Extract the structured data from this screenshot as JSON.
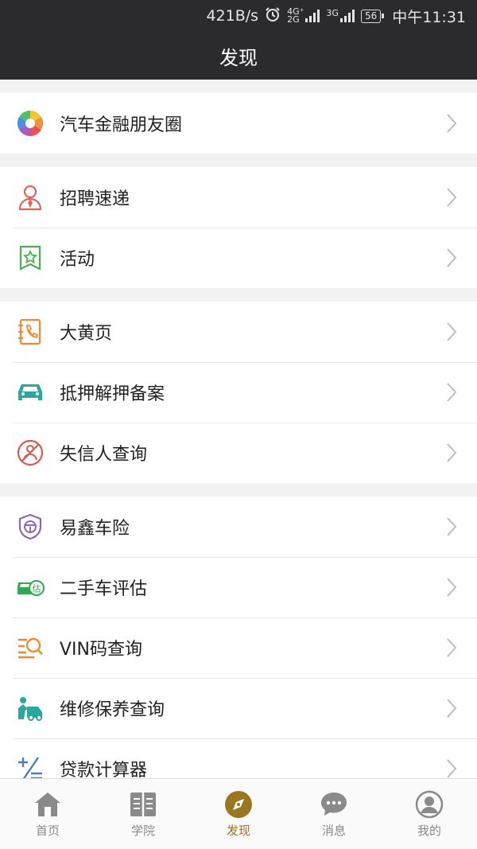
{
  "status_bar": {
    "speed": "421B/s",
    "net1": "4G⁺",
    "net1b": "2G",
    "net2": "3G",
    "battery": "56",
    "time": "中午11:31"
  },
  "header": {
    "title": "发现"
  },
  "groups": [
    {
      "items": [
        {
          "label": "汽车金融朋友圈",
          "icon": "color-aperture-icon"
        }
      ]
    },
    {
      "items": [
        {
          "label": "招聘速递",
          "icon": "person-tie-icon"
        },
        {
          "label": "活动",
          "icon": "star-bookmark-icon"
        }
      ]
    },
    {
      "items": [
        {
          "label": "大黄页",
          "icon": "phone-book-icon"
        },
        {
          "label": "抵押解押备案",
          "icon": "car-icon"
        },
        {
          "label": "失信人查询",
          "icon": "person-banned-icon"
        }
      ]
    },
    {
      "items": [
        {
          "label": "易鑫车险",
          "icon": "steering-shield-icon"
        },
        {
          "label": "二手车评估",
          "icon": "car-estimate-icon"
        },
        {
          "label": "VIN码查询",
          "icon": "list-search-icon"
        },
        {
          "label": "维修保养查询",
          "icon": "car-repair-icon"
        },
        {
          "label": "贷款计算器",
          "icon": "calculator-icon"
        }
      ]
    }
  ],
  "tabbar": {
    "tabs": [
      {
        "label": "首页",
        "icon": "home-icon"
      },
      {
        "label": "学院",
        "icon": "book-icon"
      },
      {
        "label": "发现",
        "icon": "compass-icon",
        "active": true
      },
      {
        "label": "消息",
        "icon": "chat-bubble-icon"
      },
      {
        "label": "我的",
        "icon": "user-avatar-icon"
      }
    ]
  },
  "colors": {
    "header_bg": "#2b2b2d",
    "active_tab": "#9b7621",
    "inactive_tab": "#8a8a8a"
  },
  "estimate_badge": "估"
}
